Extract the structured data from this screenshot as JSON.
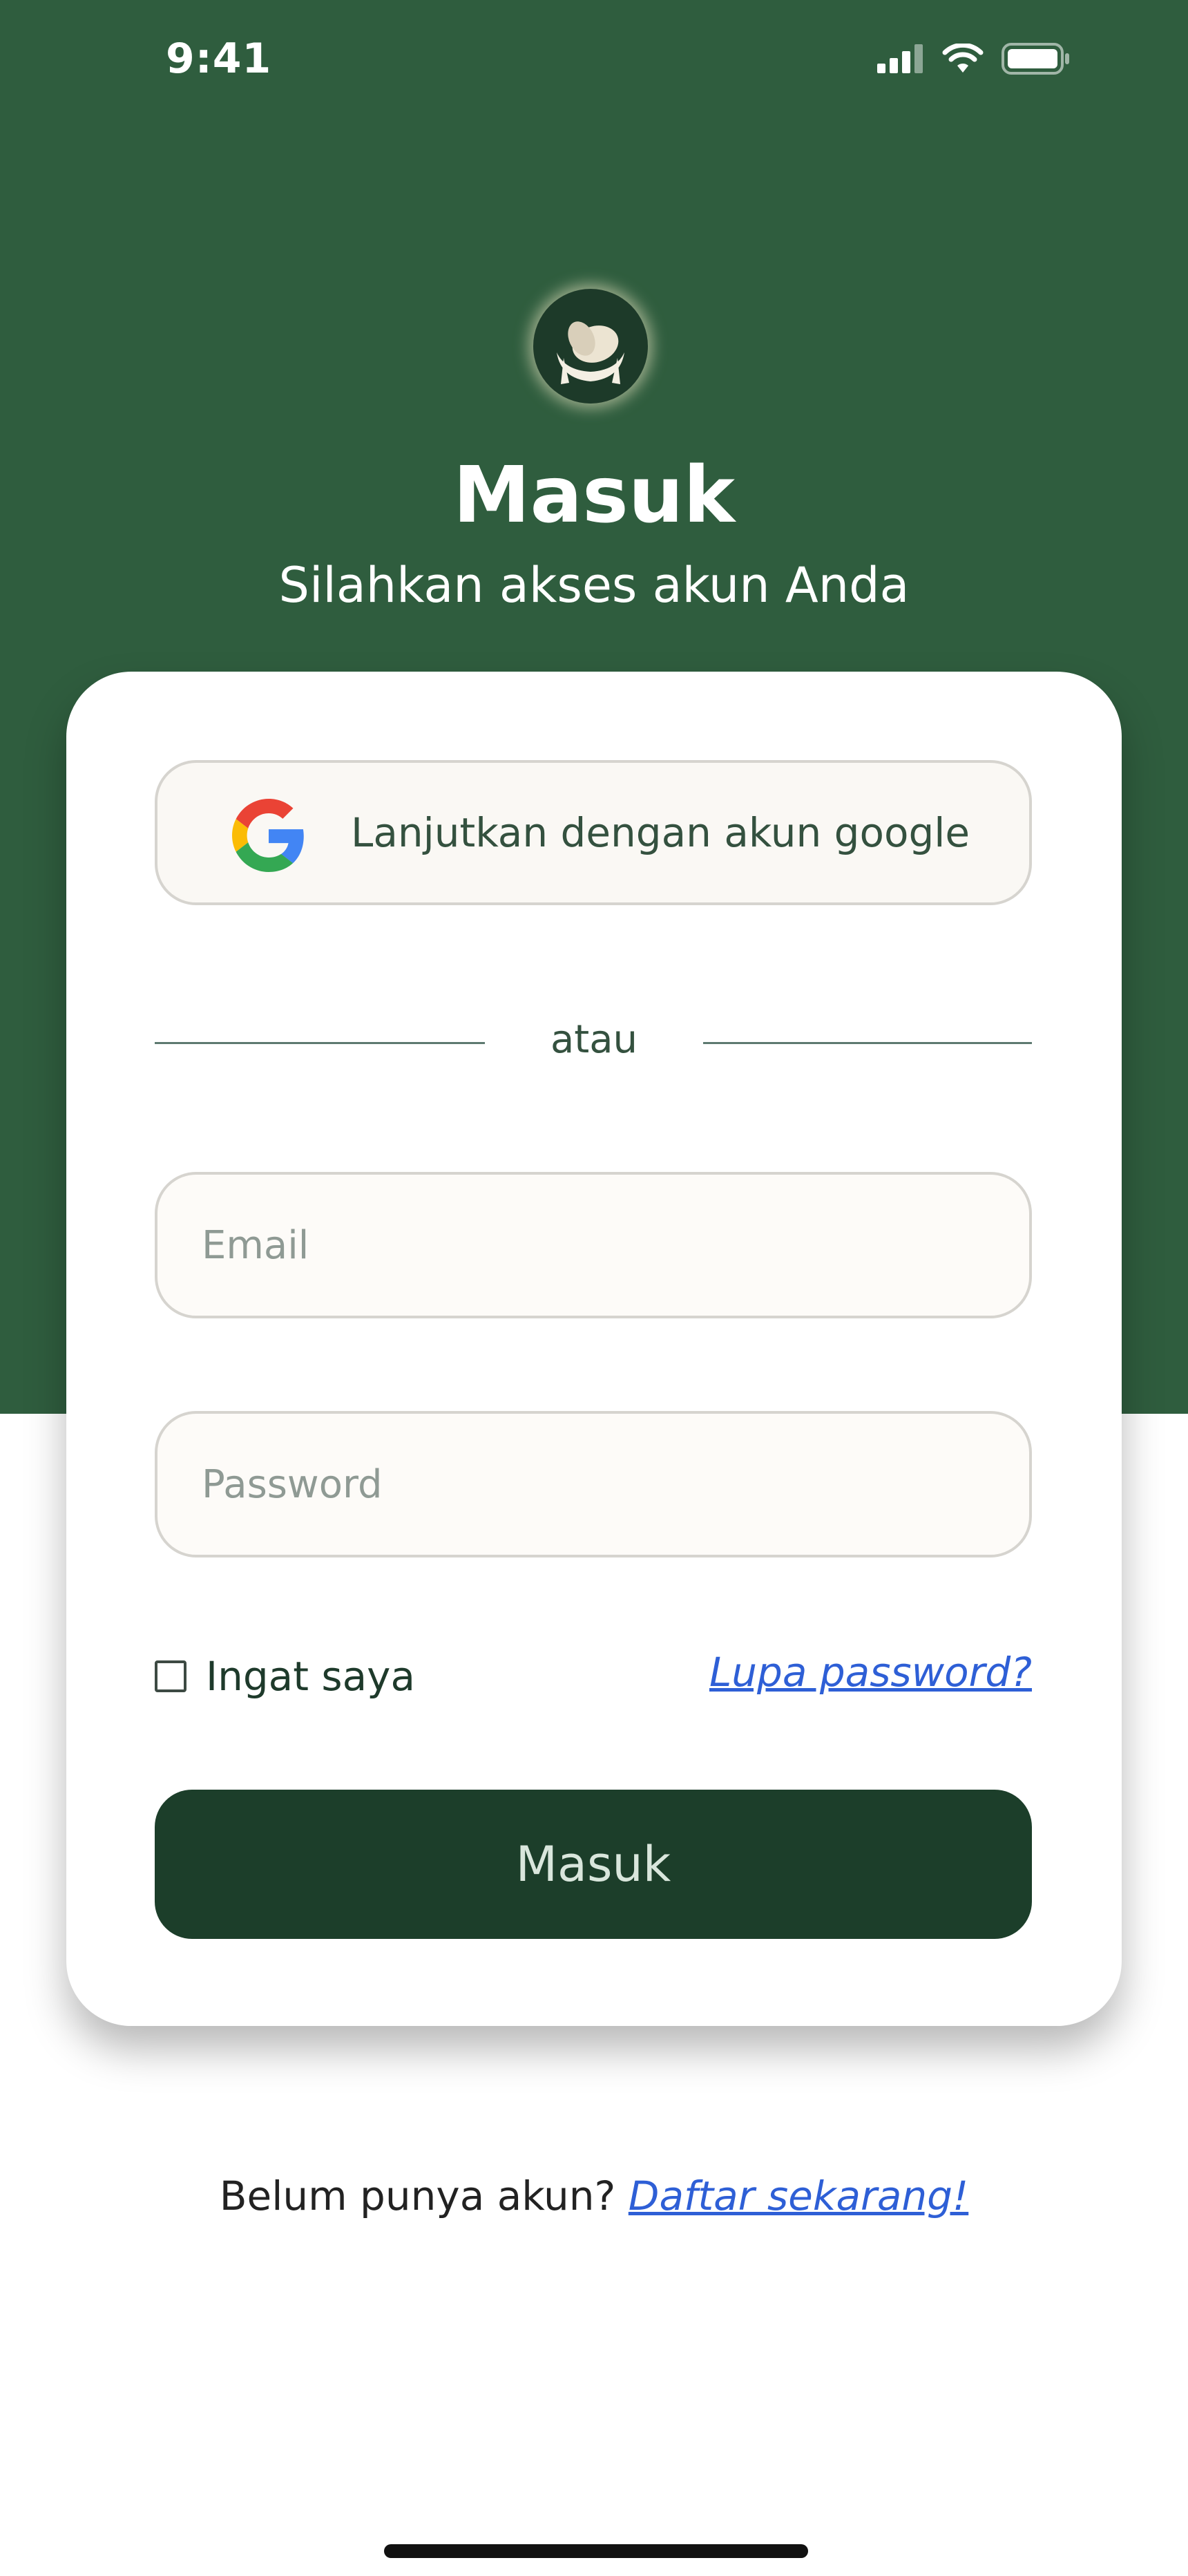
{
  "status_bar": {
    "time": "9:41",
    "icons": [
      "signal-icon",
      "wifi-icon",
      "battery-icon"
    ]
  },
  "header": {
    "logo_icon": "logo-hands-heart-icon",
    "title": "Masuk",
    "subtitle": "Silahkan akses akun Anda"
  },
  "form": {
    "google_button_label": "Lanjutkan dengan akun google",
    "divider_text": "atau",
    "email_placeholder": "Email",
    "password_placeholder": "Password",
    "remember_label": "Ingat saya",
    "remember_checked": false,
    "forgot_label": "Lupa password?",
    "submit_label": "Masuk"
  },
  "footer": {
    "prompt": "Belum punya akun?",
    "signup_label": "Daftar sekarang!"
  },
  "colors": {
    "hero_bg": "#2f5d3e",
    "primary_button": "#1c3e2a",
    "link": "#2e5fd6"
  }
}
